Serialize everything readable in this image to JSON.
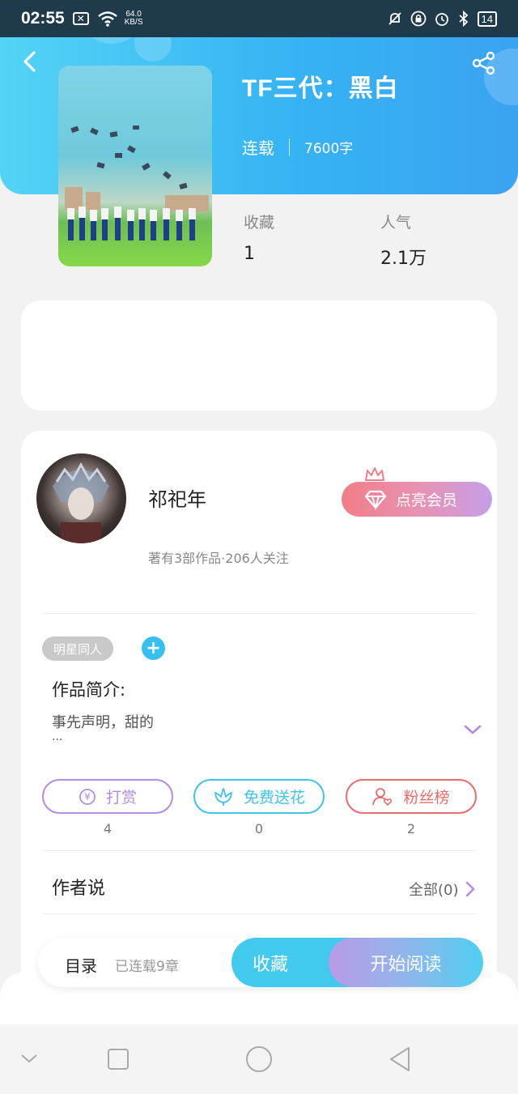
{
  "status_bar": {
    "time": "02:55",
    "network_speed_value": "64.0",
    "network_speed_unit": "KB/S",
    "battery": "14"
  },
  "book": {
    "title": "TF三代：黑白",
    "status": "连载",
    "word_count": "7600字",
    "stats": [
      {
        "label": "收藏",
        "value": "1"
      },
      {
        "label": "人气",
        "value": "2.1万"
      }
    ]
  },
  "author": {
    "name": "祁祀年",
    "info": "著有3部作品·206人关注",
    "vip_button": "点亮会员"
  },
  "tags": [
    "明星同人"
  ],
  "tag_add": "+",
  "intro": {
    "title": "作品简介:",
    "text": "事先声明，甜的",
    "ellipsis": "..."
  },
  "actions": [
    {
      "label": "打赏",
      "count": "4",
      "color": "#b38ce6",
      "icon": "yen-coin-icon"
    },
    {
      "label": "免费送花",
      "count": "0",
      "color": "#3ec3ea",
      "icon": "flower-icon"
    },
    {
      "label": "粉丝榜",
      "count": "2",
      "color": "#ea6b6b",
      "icon": "fan-user-icon"
    }
  ],
  "author_says": {
    "title": "作者说",
    "more": "全部(0)"
  },
  "bottom_bar": {
    "toc_label": "目录",
    "chapter_count": "已连载9章",
    "collect": "收藏",
    "read": "开始阅读"
  },
  "colors": {
    "header_gradient_start": "#53d4f5",
    "header_gradient_end": "#3aa3f2",
    "vip_gradient_start": "#f17d87",
    "vip_gradient_end": "#c79ee8",
    "accent_blue": "#42c9ee"
  }
}
